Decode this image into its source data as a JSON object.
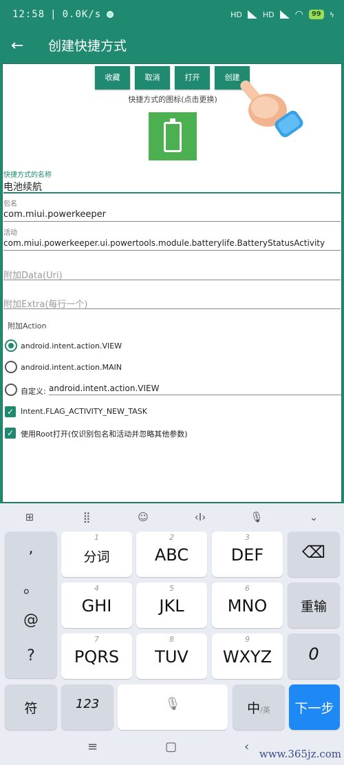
{
  "status_bar": {
    "time": "12:58",
    "speed": "0.0K/s",
    "separator": "|",
    "signal1": "HD",
    "signal2": "HD",
    "battery": "99",
    "charging_icon": "bolt-icon"
  },
  "app_bar": {
    "title": "创建快捷方式",
    "back_icon": "arrow-left-icon"
  },
  "actions": {
    "favorite": "收藏",
    "cancel": "取消",
    "open": "打开",
    "create": "创建"
  },
  "icon_caption": "快捷方式的图标(点击更换)",
  "icon_color": "#4caf50",
  "accent_color": "#1f8a70",
  "fields": {
    "name_label": "快捷方式的名称",
    "name_value": "电池续航",
    "package_label": "包名",
    "package_value": "com.miui.powerkeeper",
    "activity_label": "活动",
    "activity_value": "com.miui.powerkeeper.ui.powertools.module.batterylife.BatteryStatusActivity",
    "data_placeholder": "附加Data(Uri)",
    "extra_placeholder": "附加Extra(每行一个)"
  },
  "action_section": {
    "label": "附加Action",
    "options": [
      {
        "label": "android.intent.action.VIEW",
        "checked": true
      },
      {
        "label": "android.intent.action.MAIN",
        "checked": false
      }
    ],
    "custom_label": "自定义:",
    "custom_value": "android.intent.action.VIEW"
  },
  "checkboxes": {
    "new_task": "Intent.FLAG_ACTIVITY_NEW_TASK",
    "root": "使用Root打开(仅识别包名和活动并忽略其他参数)"
  },
  "keyboard": {
    "punct": [
      ",",
      "。",
      "@",
      "?"
    ],
    "keys": {
      "k1_num": "1",
      "k1": "分词",
      "k2_num": "2",
      "k2": "ABC",
      "k3_num": "3",
      "k3": "DEF",
      "k4_num": "4",
      "k4": "GHI",
      "k5_num": "5",
      "k5": "JKL",
      "k6_num": "6",
      "k6": "MNO",
      "k7_num": "7",
      "k7": "PQRS",
      "k8_num": "8",
      "k8": "TUV",
      "k9_num": "9",
      "k9": "WXYZ",
      "k0": "0"
    },
    "reenter": "重输",
    "symbols": "符",
    "numeric": "123",
    "lang_main": "中",
    "lang_alt": "/英",
    "next": "下一步"
  },
  "watermark": "www.365jz.com"
}
